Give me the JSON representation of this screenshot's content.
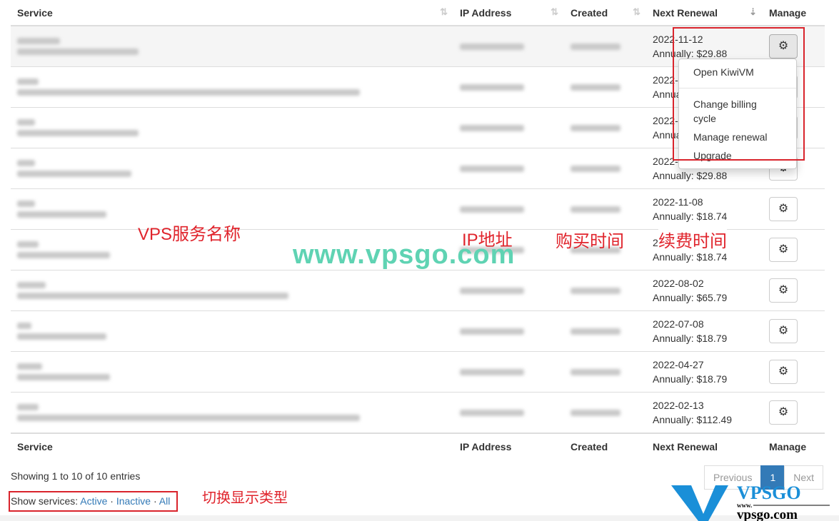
{
  "columns": [
    "Service",
    "IP Address",
    "Created",
    "Next Renewal",
    "Manage"
  ],
  "rows": [
    {
      "date": "2022-11-12",
      "price": "Annually: $29.88"
    },
    {
      "date": "2022-",
      "price": "Annua"
    },
    {
      "date": "2022-",
      "price": "Annua"
    },
    {
      "date": "2022-11-10",
      "price": "Annually: $29.88"
    },
    {
      "date": "2022-11-08",
      "price": "Annually: $18.74"
    },
    {
      "date": "20",
      "price": "Annually: $18.74"
    },
    {
      "date": "2022-08-02",
      "price": "Annually: $65.79"
    },
    {
      "date": "2022-07-08",
      "price": "Annually: $18.79"
    },
    {
      "date": "2022-04-27",
      "price": "Annually: $18.79"
    },
    {
      "date": "2022-02-13",
      "price": "Annually: $112.49"
    }
  ],
  "dropdown": [
    "Open KiwiVM",
    "Change billing cycle",
    "Manage renewal",
    "Upgrade"
  ],
  "info": "Showing 1 to 10 of 10 entries",
  "show": {
    "label": "Show services: ",
    "active": "Active",
    "inactive": "Inactive",
    "all": "All",
    "sep": " · "
  },
  "pagination": {
    "prev": "Previous",
    "page": "1",
    "next": "Next"
  },
  "annotations": {
    "service": "VPS服务名称",
    "ip": "IP地址",
    "created": "购买时间",
    "renewal": "续费时间",
    "toggle": "切换显示类型"
  },
  "watermark": "www.vpsgo.com",
  "logo": {
    "text": "VPSGO",
    "sub": "www.",
    "domain": "vpsgo.com"
  },
  "colors": {
    "link": "#337ab7",
    "annotation": "#e0242c",
    "watermark": "#5fd3b3"
  }
}
